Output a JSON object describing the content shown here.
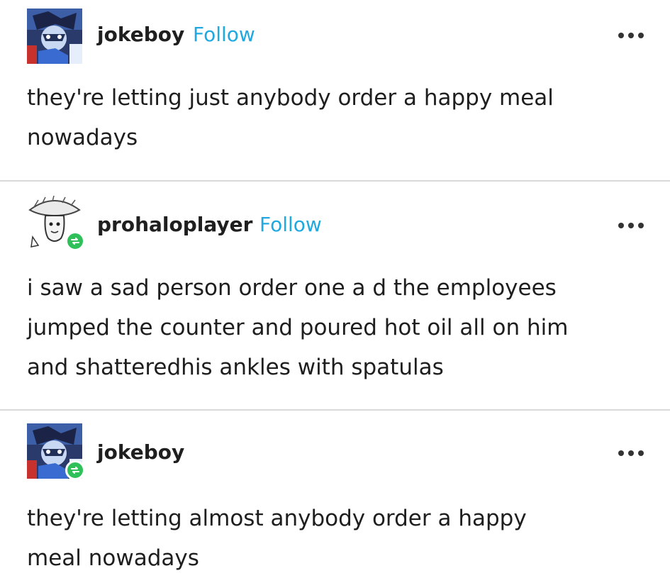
{
  "posts": [
    {
      "username": "jokeboy",
      "follow_label": "Follow",
      "avatar_icon": "anime-character-avatar-icon",
      "reblogged": false,
      "more_icon": "ellipsis-icon",
      "text": "they're letting just anybody order a happy meal\nnowadays"
    },
    {
      "username": "prohaloplayer",
      "follow_label": "Follow",
      "avatar_icon": "mushroom-character-avatar-icon",
      "reblogged": true,
      "more_icon": "ellipsis-icon",
      "text": "i saw a sad person order one a d the employees\njumped the counter and poured hot oil all on him\nand shatteredhis ankles with spatulas"
    },
    {
      "username": "jokeboy",
      "follow_label": "",
      "avatar_icon": "anime-character-avatar-icon",
      "reblogged": true,
      "more_icon": "ellipsis-icon",
      "text": "they're letting almost anybody order a happy\nmeal nowadays"
    }
  ],
  "colors": {
    "follow": "#1fa9e0",
    "reblog_badge": "#2fc05a",
    "divider": "#d9d9d9"
  }
}
